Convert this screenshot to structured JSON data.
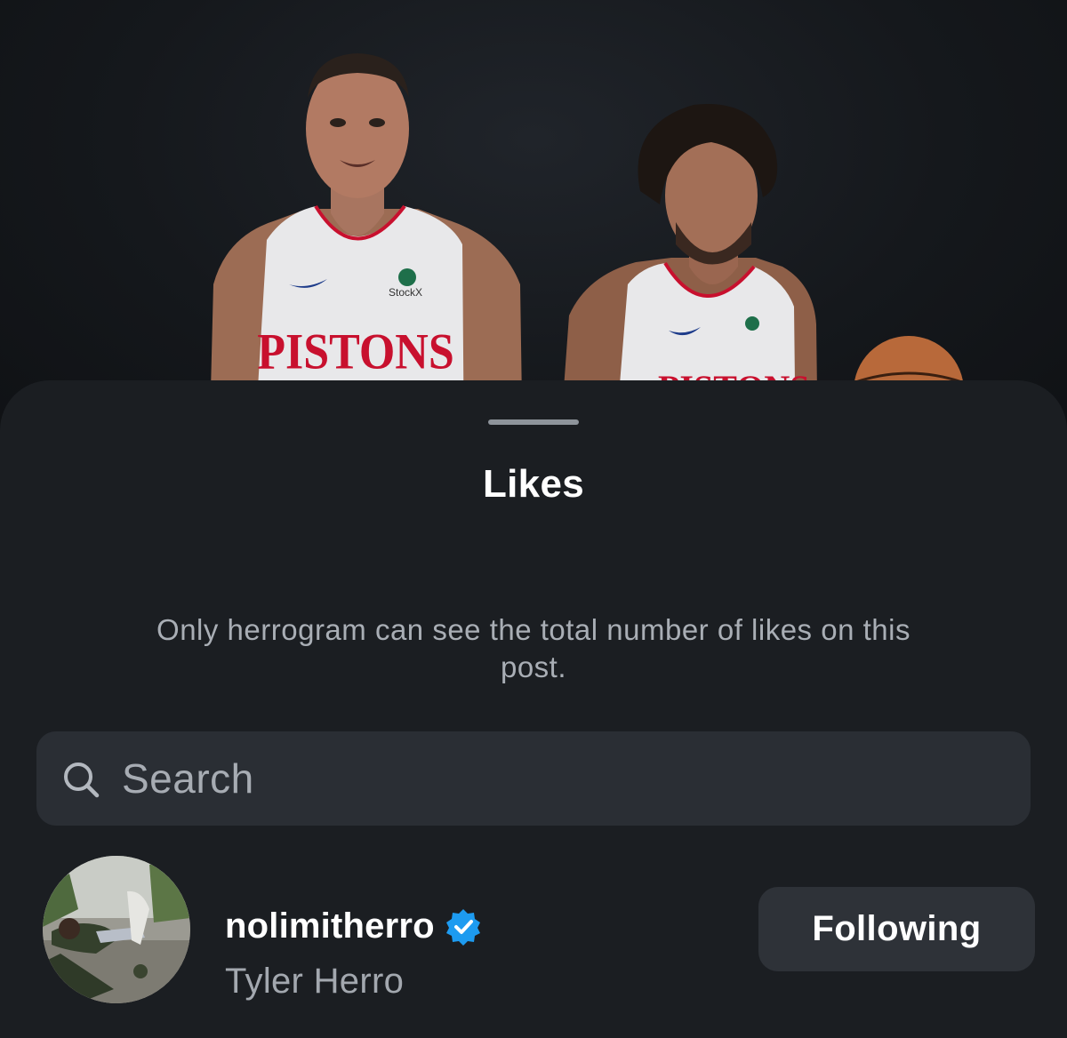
{
  "post": {
    "jersey_left": "PISTONS",
    "jersey_right": "PISTONS",
    "sponsor": "StockX"
  },
  "sheet": {
    "title": "Likes",
    "privacy_note": "Only herrogram can see the total number of likes on this post."
  },
  "search": {
    "placeholder": "Search",
    "value": ""
  },
  "likes_list": [
    {
      "username": "nolimitherro",
      "full_name": "Tyler Herro",
      "verified": true,
      "button_label": "Following"
    }
  ],
  "colors": {
    "sheet_background": "#1b1e22",
    "search_background": "#2a2e34",
    "button_background": "#2e3238",
    "verified_blue": "#1d9bf0",
    "secondary_text": "#a3a8af",
    "jersey_red": "#c8102e"
  },
  "icons": {
    "search": "search-icon",
    "verified": "verified-badge-icon"
  }
}
